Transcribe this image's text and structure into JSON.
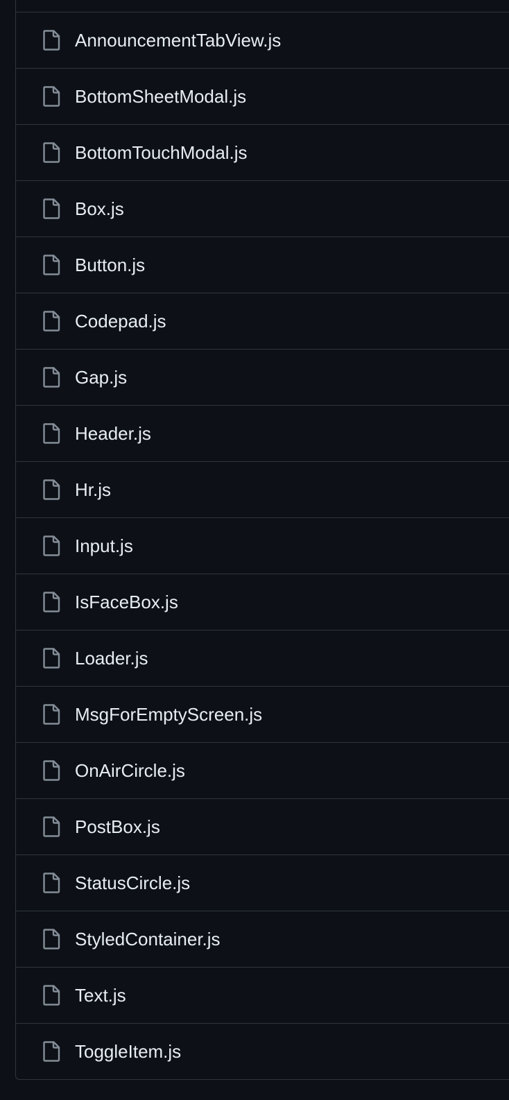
{
  "files": [
    {
      "name": "AnnouncementTabView.js",
      "icon": "file-icon"
    },
    {
      "name": "BottomSheetModal.js",
      "icon": "file-icon"
    },
    {
      "name": "BottomTouchModal.js",
      "icon": "file-icon"
    },
    {
      "name": "Box.js",
      "icon": "file-icon"
    },
    {
      "name": "Button.js",
      "icon": "file-icon"
    },
    {
      "name": "Codepad.js",
      "icon": "file-icon"
    },
    {
      "name": "Gap.js",
      "icon": "file-icon"
    },
    {
      "name": "Header.js",
      "icon": "file-icon"
    },
    {
      "name": "Hr.js",
      "icon": "file-icon"
    },
    {
      "name": "Input.js",
      "icon": "file-icon"
    },
    {
      "name": "IsFaceBox.js",
      "icon": "file-icon"
    },
    {
      "name": "Loader.js",
      "icon": "file-icon"
    },
    {
      "name": "MsgForEmptyScreen.js",
      "icon": "file-icon"
    },
    {
      "name": "OnAirCircle.js",
      "icon": "file-icon"
    },
    {
      "name": "PostBox.js",
      "icon": "file-icon"
    },
    {
      "name": "StatusCircle.js",
      "icon": "file-icon"
    },
    {
      "name": "StyledContainer.js",
      "icon": "file-icon"
    },
    {
      "name": "Text.js",
      "icon": "file-icon"
    },
    {
      "name": "ToggleItem.js",
      "icon": "file-icon"
    }
  ],
  "colors": {
    "background": "#0d1117",
    "border": "#30363d",
    "text": "#e6edf3",
    "icon": "#848d97"
  }
}
